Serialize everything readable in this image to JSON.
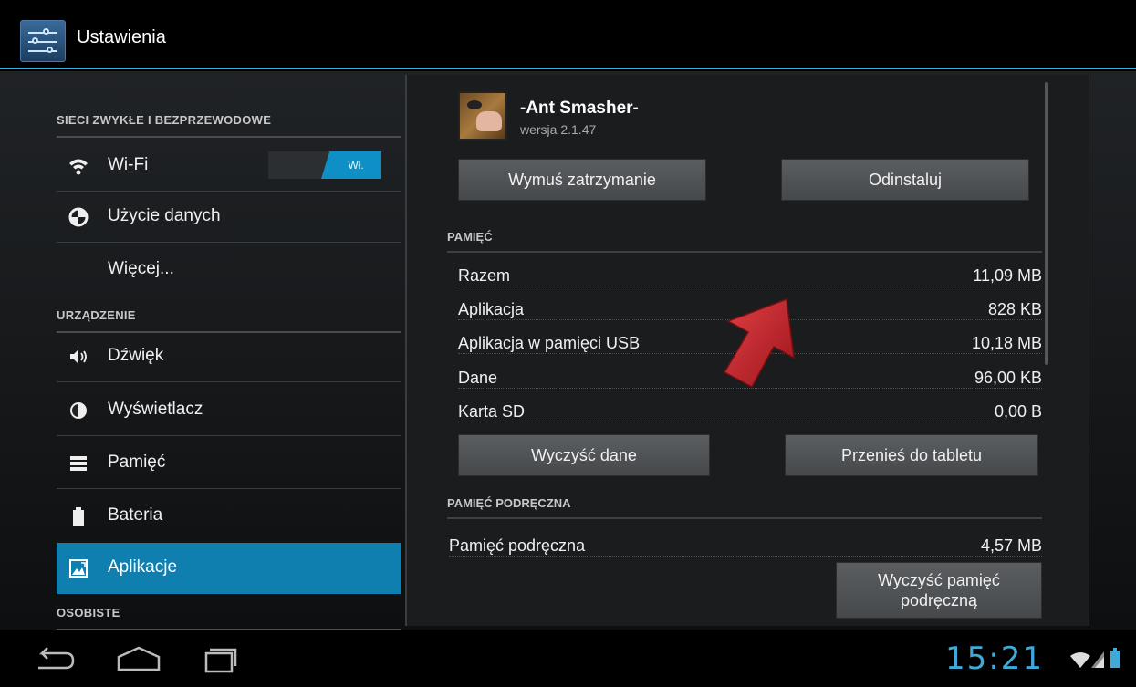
{
  "actionbar": {
    "title": "Ustawienia",
    "icon": "settings-sliders-icon"
  },
  "sidebar": {
    "sections": [
      {
        "label": "SIECI ZWYKŁE I BEZPRZEWODOWE"
      },
      {
        "label": "URZĄDZENIE"
      },
      {
        "label": "OSOBISTE"
      }
    ],
    "items": [
      {
        "label": "Wi-Fi",
        "icon": "wifi-icon",
        "toggle": "Wł."
      },
      {
        "label": "Użycie danych",
        "icon": "data-usage-icon"
      },
      {
        "label": "Więcej..."
      },
      {
        "label": "Dźwięk",
        "icon": "sound-icon"
      },
      {
        "label": "Wyświetlacz",
        "icon": "display-icon"
      },
      {
        "label": "Pamięć",
        "icon": "storage-icon"
      },
      {
        "label": "Bateria",
        "icon": "battery-icon"
      },
      {
        "label": "Aplikacje",
        "icon": "apps-icon",
        "active": true
      }
    ]
  },
  "detail": {
    "app_name": "-Ant Smasher-",
    "app_version": "wersja 2.1.47",
    "force_stop_label": "Wymuś zatrzymanie",
    "uninstall_label": "Odinstaluj",
    "storage_section": "PAMIĘĆ",
    "storage_rows": [
      {
        "label": "Razem",
        "value": "11,09 MB"
      },
      {
        "label": "Aplikacja",
        "value": "828 KB"
      },
      {
        "label": "Aplikacja w pamięci USB",
        "value": "10,18 MB"
      },
      {
        "label": "Dane",
        "value": "96,00 KB"
      },
      {
        "label": "Karta SD",
        "value": "0,00 B"
      }
    ],
    "clear_data_label": "Wyczyść dane",
    "move_label": "Przenieś do tabletu",
    "cache_section": "PAMIĘĆ PODRĘCZNA",
    "cache_row": {
      "label": "Pamięć podręczna",
      "value": "4,57 MB"
    },
    "clear_cache_line1": "Wyczyść pamięć",
    "clear_cache_line2": "podręczną"
  },
  "statusbar": {
    "time": "15:21"
  },
  "colors": {
    "accent": "#33b5e5",
    "selected": "#0f7fb0",
    "arrow": "#d9262b"
  }
}
